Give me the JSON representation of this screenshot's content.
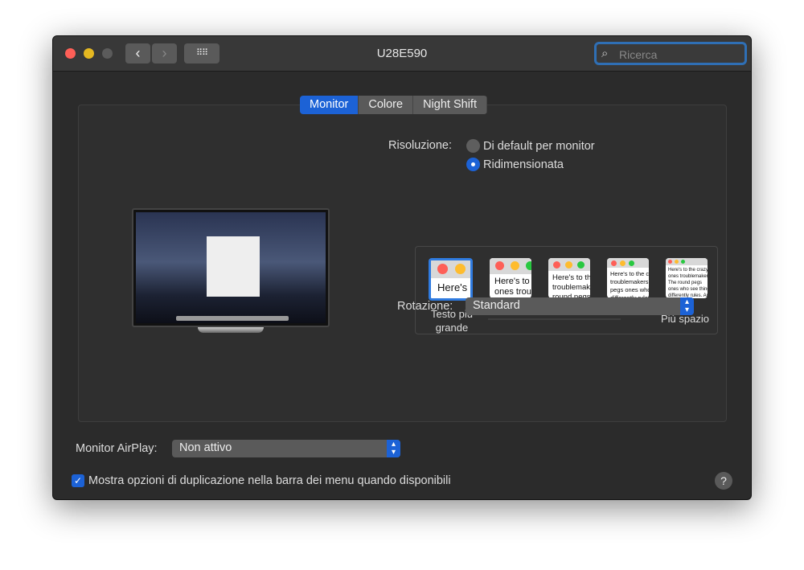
{
  "window": {
    "title": "U28E590",
    "search_placeholder": "Ricerca"
  },
  "tabs": [
    {
      "label": "Monitor",
      "active": true
    },
    {
      "label": "Colore",
      "active": false
    },
    {
      "label": "Night Shift",
      "active": false
    }
  ],
  "resolution": {
    "label": "Risoluzione:",
    "options": [
      {
        "label": "Di default per monitor",
        "selected": false
      },
      {
        "label": "Ridimensionata",
        "selected": true
      }
    ],
    "scale_left": "Testo più grande",
    "scale_right": "Più spazio",
    "sample_text": "Here's to the crazy ones troublemakers. The round pegs ones who see things differently rules. And they have no respect can quote them, disagree with them. About the only thing Because they change things"
  },
  "rotation": {
    "label": "Rotazione:",
    "value": "Standard"
  },
  "airplay": {
    "label": "Monitor AirPlay:",
    "value": "Non attivo"
  },
  "mirroring_checkbox": {
    "label": "Mostra opzioni di duplicazione nella barra dei menu quando disponibili",
    "checked": true
  },
  "help": "?",
  "colors": {
    "accent": "#1c62d6",
    "close": "#fe5f57",
    "minimize": "#e5b821"
  }
}
